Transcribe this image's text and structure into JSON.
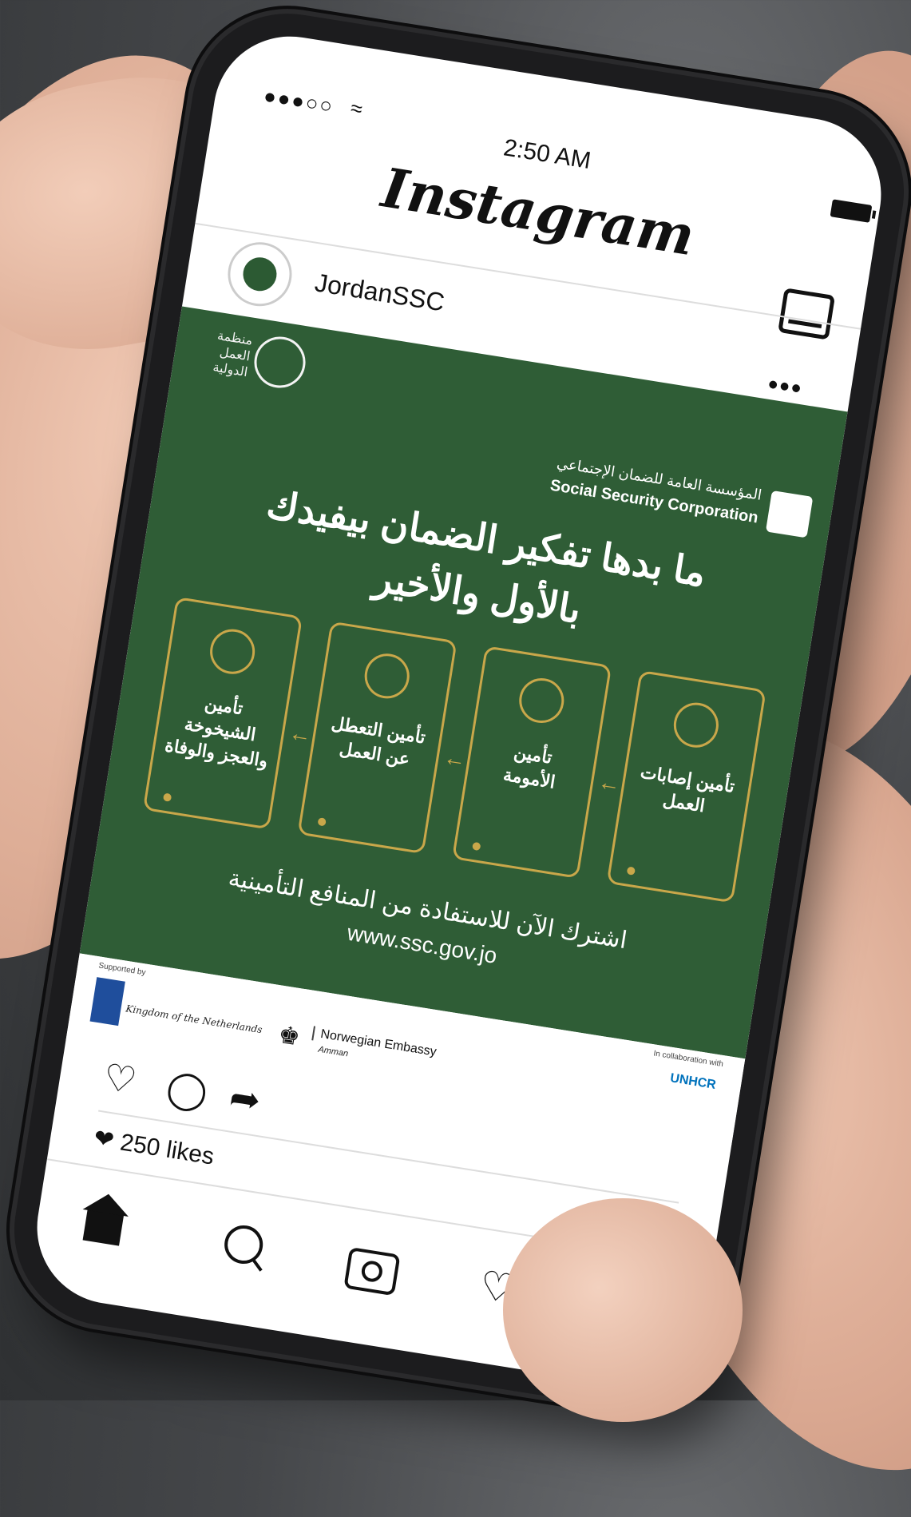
{
  "status": {
    "signal": "●●●○○",
    "time": "2:50 AM"
  },
  "app": {
    "brand": "Instagram"
  },
  "post": {
    "username": "JordanSSC",
    "more": "•••",
    "ilo_label": "منظمة العمل الدولية",
    "ssc_name_ar": "المؤسسة العامة للضمان الإجتماعي",
    "ssc_name_en": "Social Security Corporation",
    "headline_line1": "ما بدها تفكير الضمان بيفيدك",
    "headline_line2": "بالأول والأخير",
    "cards": [
      {
        "label_1": "تأمين",
        "label_2": "الشيخوخة",
        "label_3": "والعجز والوفاة"
      },
      {
        "label_1": "تأمين التعطل",
        "label_2": "عن العمل",
        "label_3": ""
      },
      {
        "label_1": "تأمين",
        "label_2": "الأمومة",
        "label_3": ""
      },
      {
        "label_1": "تأمين إصابات",
        "label_2": "العمل",
        "label_3": ""
      }
    ],
    "subscribe": "اشترك الآن للاستفادة من المنافع التأمينية",
    "website": "www.ssc.gov.jo",
    "sponsors": {
      "supported_by": "Supported by",
      "netherlands": "Kingdom of the Netherlands",
      "norway": "Norwegian Embassy",
      "norway_city": "Amman",
      "collab": "In collaboration with",
      "unhcr": "UNHCR"
    },
    "likes": "250 likes"
  }
}
